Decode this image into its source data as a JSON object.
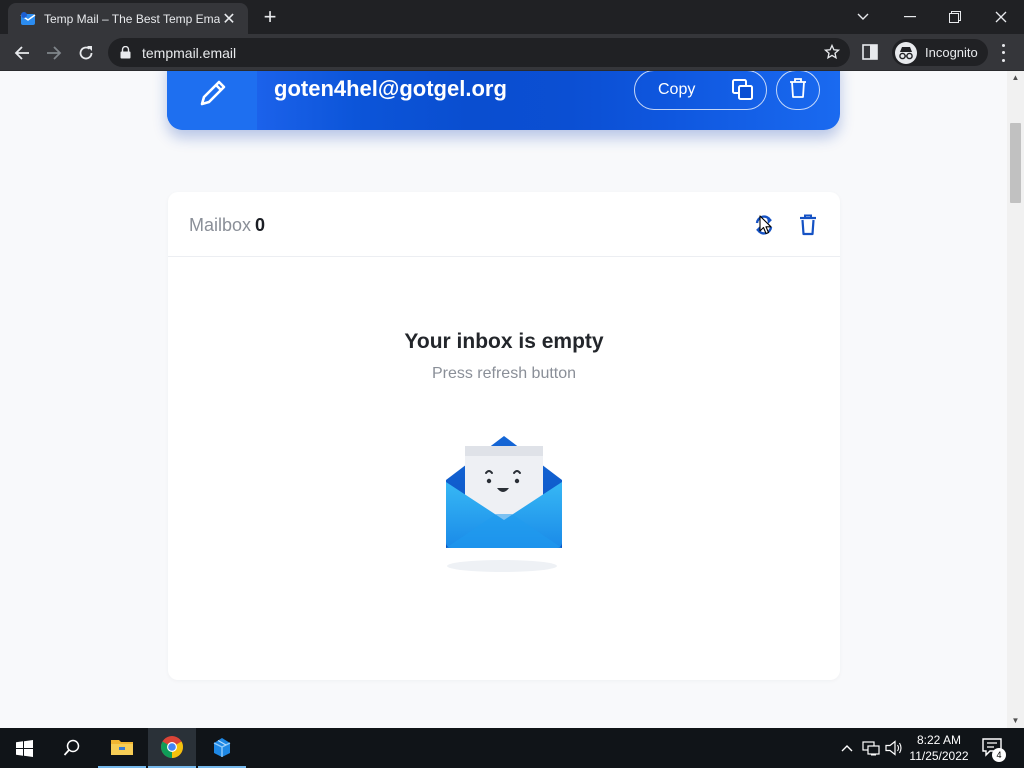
{
  "browser": {
    "tab_title": "Temp Mail – The Best Temp Email",
    "url": "tempmail.email",
    "incognito_label": "Incognito"
  },
  "email_bar": {
    "address": "goten4hel@gotgel.org",
    "copy_label": "Copy"
  },
  "mailbox": {
    "title": "Mailbox",
    "count": "0",
    "empty_title": "Your inbox is empty",
    "empty_subtitle": "Press refresh button"
  },
  "taskbar": {
    "time": "8:22 AM",
    "date": "11/25/2022",
    "notification_count": "4"
  },
  "colors": {
    "accent": "#0f5ce0",
    "icon_blue": "#1552c4",
    "chrome_dark": "#202124",
    "chrome_toolbar": "#35363a"
  }
}
